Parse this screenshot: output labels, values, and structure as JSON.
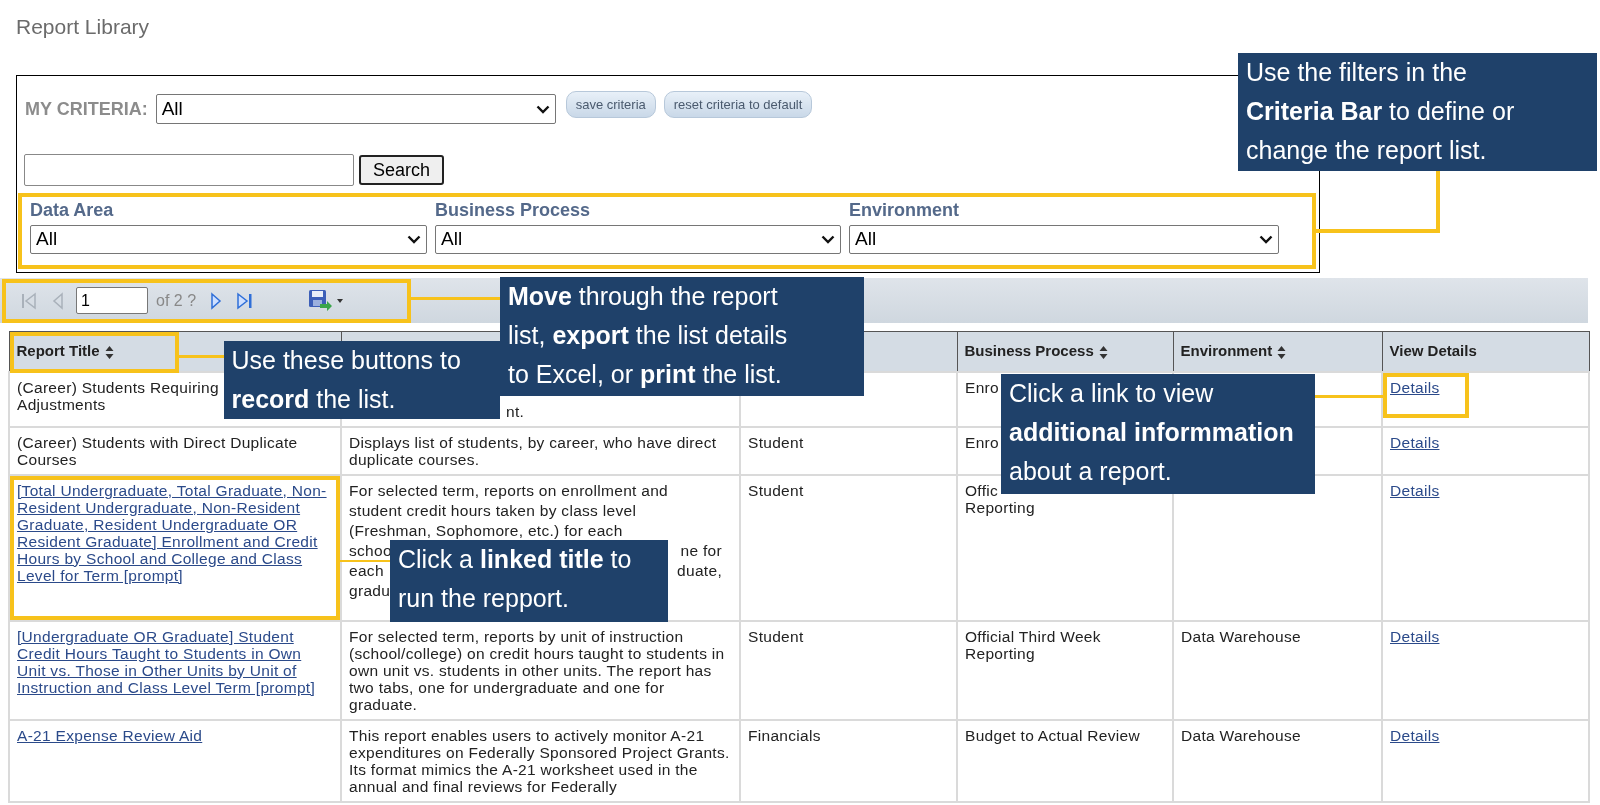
{
  "page_title": "Report Library",
  "criteria": {
    "label": "MY CRITERIA:",
    "value": "All",
    "buttons": [
      "save criteria",
      "reset criteria to default"
    ],
    "search_button": "Search",
    "filters": [
      {
        "label": "Data Area",
        "value": "All"
      },
      {
        "label": "Business Process",
        "value": "All"
      },
      {
        "label": "Environment",
        "value": "All"
      }
    ]
  },
  "pager": {
    "page": "1",
    "of": "of 2 ?"
  },
  "table": {
    "columns": [
      {
        "kind": "sortable",
        "label": "Report Title"
      },
      {
        "kind": "blank"
      },
      {
        "kind": "blank"
      },
      {
        "kind": "sortable",
        "label": "Business Process"
      },
      {
        "kind": "sortable",
        "label": "Environment"
      },
      {
        "kind": "plain",
        "label": "View Details"
      }
    ],
    "rows": [
      {
        "cells": [
          {
            "kind": "text",
            "text": "(Career) Students Requiring\nAdjustments"
          },
          {
            "kind": "tail",
            "text": "nt."
          },
          {
            "kind": "blank"
          },
          {
            "kind": "text",
            "text": "Enro"
          },
          {
            "kind": "blank"
          },
          {
            "kind": "link",
            "text": "Details"
          }
        ]
      },
      {
        "cells": [
          {
            "kind": "text",
            "text": "(Career) Students with Direct Duplicate Courses"
          },
          {
            "kind": "text",
            "text": "Displays list of students, by career, who have direct duplicate courses."
          },
          {
            "kind": "text",
            "text": "Student"
          },
          {
            "kind": "text",
            "text": "Enro"
          },
          {
            "kind": "blank"
          },
          {
            "kind": "link",
            "text": "Details"
          }
        ]
      },
      {
        "cells": [
          {
            "kind": "link",
            "text": "[Total Undergraduate, Total Graduate, Non-Resident Undergraduate, Non-Resident Graduate, Resident Undergraduate OR Resident Graduate] Enrollment and Credit Hours by School and College and Class Level for Term [prompt]"
          },
          {
            "kind": "split",
            "lines": [
              [
                "For selected term, reports on enrollment and"
              ],
              [
                "student credit hours taken by class level"
              ],
              [
                "(Freshman, Sophomore, etc.) for each"
              ],
              [
                "schoo",
                "ne for"
              ],
              [
                "each",
                "duate,"
              ],
              [
                "gradu"
              ]
            ]
          },
          {
            "kind": "text",
            "text": "Student"
          },
          {
            "kind": "text",
            "text": "Offic\nReporting"
          },
          {
            "kind": "blank"
          },
          {
            "kind": "link",
            "text": "Details"
          }
        ]
      },
      {
        "cells": [
          {
            "kind": "link",
            "text": "[Undergraduate OR Graduate] Student Credit Hours Taught to Students in Own Unit vs. Those in Other Units by Unit of Instruction and Class Level Term [prompt]"
          },
          {
            "kind": "text",
            "text": "For selected term, reports by unit of instruction (school/college) on credit hours taught to students in own unit vs. students in other units.  The report has two tabs, one for undergraduate and one for graduate."
          },
          {
            "kind": "text",
            "text": "Student"
          },
          {
            "kind": "text",
            "text": "Official Third Week Reporting"
          },
          {
            "kind": "text",
            "text": "Data Warehouse"
          },
          {
            "kind": "link",
            "text": "Details"
          }
        ]
      },
      {
        "cells": [
          {
            "kind": "link",
            "text": "A-21 Expense Review Aid"
          },
          {
            "kind": "text",
            "text": "This report enables users to actively monitor A-21 expenditures on Federally Sponsored Project Grants. Its format mimics the A-21 worksheet used in the annual and final reviews for Federally"
          },
          {
            "kind": "text",
            "text": "Financials"
          },
          {
            "kind": "text",
            "text": "Budget to Actual Review"
          },
          {
            "kind": "text",
            "text": "Data Warehouse"
          },
          {
            "kind": "link",
            "text": "Details"
          }
        ]
      }
    ]
  },
  "callouts": [
    {
      "text": "Use the filters in the\n**Criteria Bar** to define or\nchange the report list."
    },
    {
      "text": "**Move** through the report\nlist, **export** the list details\nto Excel, or **print** the list."
    },
    {
      "text": "Use these buttons to\n**record** the list."
    },
    {
      "text": "Click a link to view\n**additional informmation**\nabout a report."
    },
    {
      "text": "Click a **linked title** to\nrun the repport."
    }
  ]
}
